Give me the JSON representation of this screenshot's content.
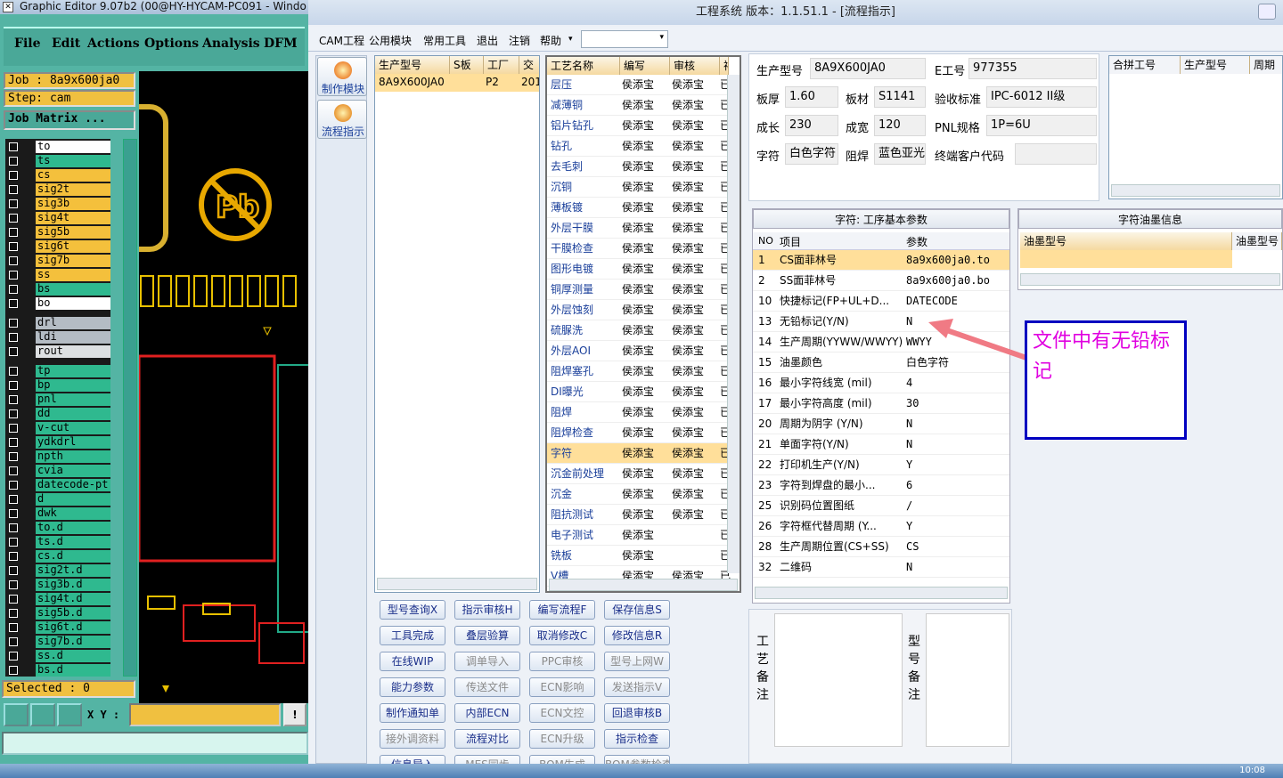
{
  "ge": {
    "title": "Graphic Editor 9.07b2 (00@HY-HYCAM-PC091 - Windo",
    "menu": [
      "File",
      "Edit",
      "Actions",
      "Options",
      "Analysis",
      "DFM"
    ],
    "job": "Job : 8a9x600ja0",
    "step": "Step: cam",
    "job_matrix": "Job Matrix ...",
    "layers": [
      {
        "name": "to",
        "color": "#ffffff"
      },
      {
        "name": "ts",
        "color": "#2fb98f"
      },
      {
        "name": "cs",
        "color": "#f4c03c"
      },
      {
        "name": "sig2t",
        "color": "#f4c03c"
      },
      {
        "name": "sig3b",
        "color": "#f4c03c"
      },
      {
        "name": "sig4t",
        "color": "#f4c03c"
      },
      {
        "name": "sig5b",
        "color": "#f4c03c"
      },
      {
        "name": "sig6t",
        "color": "#f4c03c"
      },
      {
        "name": "sig7b",
        "color": "#f4c03c"
      },
      {
        "name": "ss",
        "color": "#f4c03c"
      },
      {
        "name": "bs",
        "color": "#2fb98f"
      },
      {
        "name": "bo",
        "color": "#ffffff"
      },
      {
        "name": "drl",
        "color": "#b4bcc4"
      },
      {
        "name": "ldi",
        "color": "#b4bcc4"
      },
      {
        "name": "rout",
        "color": "#dde0e2"
      },
      {
        "name": "tp",
        "color": "#2fb98f"
      },
      {
        "name": "bp",
        "color": "#2fb98f"
      },
      {
        "name": "pnl",
        "color": "#2fb98f"
      },
      {
        "name": "dd",
        "color": "#2fb98f"
      },
      {
        "name": "v-cut",
        "color": "#2fb98f"
      },
      {
        "name": "ydkdrl",
        "color": "#2fb98f"
      },
      {
        "name": "npth",
        "color": "#2fb98f"
      },
      {
        "name": "cvia",
        "color": "#2fb98f"
      },
      {
        "name": "datecode-pt",
        "color": "#2fb98f"
      },
      {
        "name": "d",
        "color": "#2fb98f"
      },
      {
        "name": "dwk",
        "color": "#2fb98f"
      },
      {
        "name": "to.d",
        "color": "#2fb98f"
      },
      {
        "name": "ts.d",
        "color": "#2fb98f"
      },
      {
        "name": "cs.d",
        "color": "#2fb98f"
      },
      {
        "name": "sig2t.d",
        "color": "#2fb98f"
      },
      {
        "name": "sig3b.d",
        "color": "#2fb98f"
      },
      {
        "name": "sig4t.d",
        "color": "#2fb98f"
      },
      {
        "name": "sig5b.d",
        "color": "#2fb98f"
      },
      {
        "name": "sig6t.d",
        "color": "#2fb98f"
      },
      {
        "name": "sig7b.d",
        "color": "#2fb98f"
      },
      {
        "name": "ss.d",
        "color": "#2fb98f"
      },
      {
        "name": "bs.d",
        "color": "#2fb98f"
      }
    ],
    "selected": "Selected : 0",
    "xy_label": "X Y :",
    "xy_value": ""
  },
  "main": {
    "title": "工程系统   版本：1.1.51.1 - [流程指示]",
    "menu": [
      "CAM工程",
      "公用模块",
      "常用工具",
      "退出",
      "注销",
      "帮助"
    ],
    "side_buttons": [
      "制作模块",
      "流程指示"
    ],
    "model_grid": {
      "headers": [
        "生产型号",
        "S板",
        "工厂",
        "交"
      ],
      "rows": [
        [
          "8A9X600JA0",
          "",
          "P2",
          "201"
        ]
      ]
    },
    "process_grid": {
      "headers": [
        "工艺名称",
        "编写",
        "审核",
        "祥"
      ],
      "rows": [
        [
          "层压",
          "侯添宝",
          "侯添宝",
          "已"
        ],
        [
          "减薄铜",
          "侯添宝",
          "侯添宝",
          "已"
        ],
        [
          "铝片钻孔",
          "侯添宝",
          "侯添宝",
          "已"
        ],
        [
          "钻孔",
          "侯添宝",
          "侯添宝",
          "已"
        ],
        [
          "去毛刺",
          "侯添宝",
          "侯添宝",
          "已"
        ],
        [
          "沉铜",
          "侯添宝",
          "侯添宝",
          "已"
        ],
        [
          "薄板镀",
          "侯添宝",
          "侯添宝",
          "已"
        ],
        [
          "外层干膜",
          "侯添宝",
          "侯添宝",
          "已"
        ],
        [
          "干膜检查",
          "侯添宝",
          "侯添宝",
          "已"
        ],
        [
          "图形电镀",
          "侯添宝",
          "侯添宝",
          "已"
        ],
        [
          "铜厚测量",
          "侯添宝",
          "侯添宝",
          "已"
        ],
        [
          "外层蚀刻",
          "侯添宝",
          "侯添宝",
          "已"
        ],
        [
          "硫脲洗",
          "侯添宝",
          "侯添宝",
          "已"
        ],
        [
          "外层AOI",
          "侯添宝",
          "侯添宝",
          "已"
        ],
        [
          "阻焊塞孔",
          "侯添宝",
          "侯添宝",
          "已"
        ],
        [
          "DI曝光",
          "侯添宝",
          "侯添宝",
          "已"
        ],
        [
          "阻焊",
          "侯添宝",
          "侯添宝",
          "已"
        ],
        [
          "阻焊检查",
          "侯添宝",
          "侯添宝",
          "已"
        ],
        [
          "字符",
          "侯添宝",
          "侯添宝",
          "已"
        ],
        [
          "沉金前处理",
          "侯添宝",
          "侯添宝",
          "已"
        ],
        [
          "沉金",
          "侯添宝",
          "侯添宝",
          "已"
        ],
        [
          "阻抗测试",
          "侯添宝",
          "侯添宝",
          "已"
        ],
        [
          "电子测试",
          "侯添宝",
          "",
          "已"
        ],
        [
          "铣板",
          "侯添宝",
          "",
          "已"
        ],
        [
          "V槽",
          "侯添宝",
          "侯添宝",
          "已"
        ]
      ],
      "selected_index": 18
    },
    "buttons": [
      [
        "型号查询X",
        "指示审核H",
        "编写流程F",
        "保存信息S"
      ],
      [
        "工具完成",
        "叠层验算",
        "取消修改C",
        "修改信息R"
      ],
      [
        "在线WIP",
        "调单导入",
        "PPC审核",
        "型号上网W"
      ],
      [
        "能力参数",
        "传送文件",
        "ECN影响",
        "发送指示V"
      ],
      [
        "制作通知单",
        "内部ECN",
        "ECN文控",
        "回退审核B"
      ],
      [
        "接外调资料",
        "流程对比",
        "ECN升级",
        "指示检查"
      ],
      [
        "信息导入",
        "MES同步",
        "BOM生成",
        "BOM参数检查"
      ]
    ],
    "disabled_buttons": [
      "调单导入",
      "传送文件",
      "ECN影响",
      "ECN文控",
      "接外调资料",
      "ECN升级",
      "MES同步",
      "BOM生成",
      "BOM参数检查",
      "PPC审核",
      "型号上网W",
      "发送指示V"
    ],
    "info": {
      "model_label": "生产型号",
      "model": "8A9X600JA0",
      "e_label": "E工号",
      "e": "977355",
      "thick_label": "板厚",
      "thick": "1.60",
      "mat_label": "板材",
      "mat": "S1141",
      "std_label": "验收标准",
      "std": "IPC-6012 II级",
      "len_label": "成长",
      "len": "230",
      "wid_label": "成宽",
      "wid": "120",
      "pnl_label": "PNL规格",
      "pnl": "1P=6U",
      "char_label": "字符",
      "char": "白色字符",
      "mask_label": "阻焊",
      "mask": "蓝色亚光",
      "cust_label": "终端客户代码",
      "cust": ""
    },
    "merge_grid": {
      "headers": [
        "合拼工号",
        "生产型号",
        "周期"
      ]
    },
    "param_panel": {
      "title": "字符: 工序基本参数",
      "headers": [
        "NO",
        "项目",
        "参数"
      ],
      "rows": [
        [
          "1",
          "CS面菲林号",
          "8a9x600ja0.to"
        ],
        [
          "2",
          "SS面菲林号",
          "8a9x600ja0.bo"
        ],
        [
          "10",
          "快捷标记(FP+UL+D...",
          "DATECODE"
        ],
        [
          "13",
          "无铅标记(Y/N)",
          "N"
        ],
        [
          "14",
          "生产周期(YYWW/WWYY)",
          "WWYY"
        ],
        [
          "15",
          "油墨颜色",
          "白色字符"
        ],
        [
          "16",
          "最小字符线宽 (mil)",
          "4"
        ],
        [
          "17",
          "最小字符高度 (mil)",
          "30"
        ],
        [
          "20",
          "周期为阴字 (Y/N)",
          "N"
        ],
        [
          "21",
          "单面字符(Y/N)",
          "N"
        ],
        [
          "22",
          "打印机生产(Y/N)",
          "Y"
        ],
        [
          "23",
          "字符到焊盘的最小...",
          "6"
        ],
        [
          "25",
          "识别码位置图纸",
          "/"
        ],
        [
          "26",
          "字符框代替周期 (Y...",
          "Y"
        ],
        [
          "28",
          "生产周期位置(CS+SS)",
          "CS"
        ],
        [
          "32",
          "二维码",
          "N"
        ]
      ]
    },
    "ink_panel": {
      "title": "字符油墨信息",
      "headers": [
        "油墨型号",
        "油墨型号"
      ]
    },
    "annotation": "文件中有无铅标记",
    "remarks": {
      "process_label": "工艺备注",
      "model_label": "型号备注"
    }
  },
  "taskbar": {
    "clock": "10:08"
  },
  "colors": {
    "annotation_text": "#e000e0",
    "annotation_border": "#0000c0",
    "arrow": "#f07a84",
    "row_highlight": "#ffdf9a"
  }
}
